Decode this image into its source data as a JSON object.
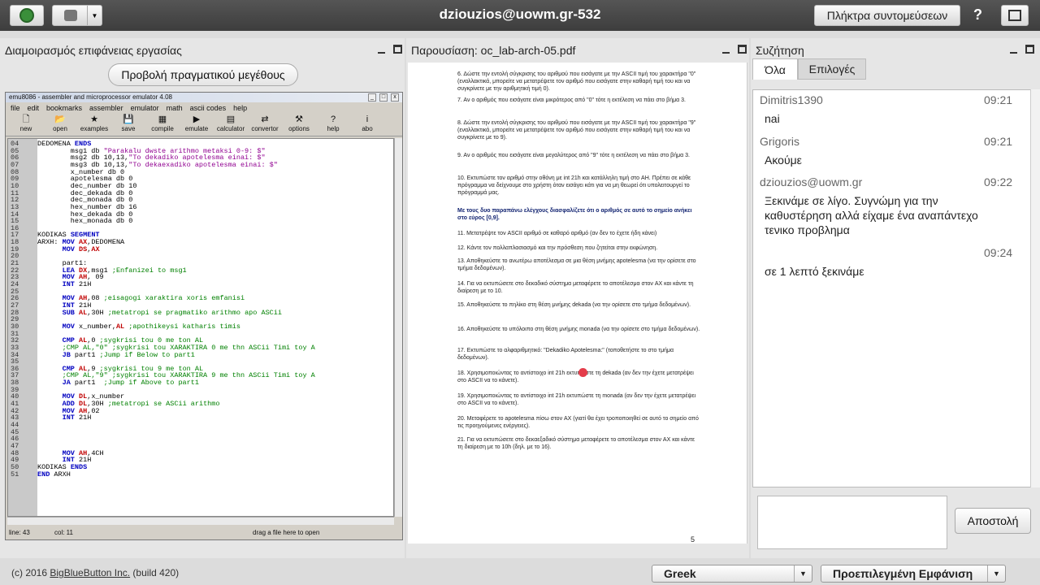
{
  "topbar": {
    "title": "dziouzios@uowm.gr-532",
    "shortcuts_label": "Πλήκτρα συντομεύσεων",
    "help_label": "?"
  },
  "desktop": {
    "title": "Διαμοιρασμός επιφάνειας εργασίας",
    "real_size_label": "Προβολή πραγματικού μεγέθους",
    "emu": {
      "title": "emu8086 - assembler and microprocessor emulator 4.08",
      "menu": [
        "file",
        "edit",
        "bookmarks",
        "assembler",
        "emulator",
        "math",
        "ascii codes",
        "help"
      ],
      "tools": [
        {
          "label": "new",
          "icon": "🗋"
        },
        {
          "label": "open",
          "icon": "📂"
        },
        {
          "label": "examples",
          "icon": "★"
        },
        {
          "label": "save",
          "icon": "💾"
        },
        {
          "label": "compile",
          "icon": "▦"
        },
        {
          "label": "emulate",
          "icon": "▶"
        },
        {
          "label": "calculator",
          "icon": "▤"
        },
        {
          "label": "convertor",
          "icon": "⇄"
        },
        {
          "label": "options",
          "icon": "⚒"
        },
        {
          "label": "help",
          "icon": "?"
        },
        {
          "label": "abo",
          "icon": "i"
        }
      ],
      "status_line": "line: 43",
      "status_col": "col: 11",
      "status_drag": "drag a file here to open"
    },
    "code": [
      {
        "n": "04",
        "t": "DEDOMENA ENDS"
      },
      {
        "n": "05",
        "t": "        msg1 db \"Parakalu dwste arithmo metaksi 0-9: $\""
      },
      {
        "n": "06",
        "t": "        msg2 db 10,13,\"To dekadiko apotelesma einai: $\""
      },
      {
        "n": "07",
        "t": "        msg3 db 10,13,\"To dekaexadiko apotelesma einai: $\""
      },
      {
        "n": "08",
        "t": "        x_number db 0"
      },
      {
        "n": "09",
        "t": "        apotelesma db 0"
      },
      {
        "n": "10",
        "t": "        dec_number db 10"
      },
      {
        "n": "11",
        "t": "        dec_dekada db 0"
      },
      {
        "n": "12",
        "t": "        dec_monada db 0"
      },
      {
        "n": "13",
        "t": "        hex_number db 16"
      },
      {
        "n": "14",
        "t": "        hex_dekada db 0"
      },
      {
        "n": "15",
        "t": "        hex_monada db 0"
      },
      {
        "n": "16",
        "t": ""
      },
      {
        "n": "17",
        "t": "KODIKAS SEGMENT"
      },
      {
        "n": "18",
        "t": "ARXH: MOV AX,DEDOMENA"
      },
      {
        "n": "19",
        "t": "      MOV DS,AX"
      },
      {
        "n": "20",
        "t": ""
      },
      {
        "n": "21",
        "t": "      part1:"
      },
      {
        "n": "22",
        "t": "      LEA DX,msg1 ;Enfanizei to msg1"
      },
      {
        "n": "23",
        "t": "      MOV AH, 09"
      },
      {
        "n": "24",
        "t": "      INT 21H"
      },
      {
        "n": "25",
        "t": ""
      },
      {
        "n": "26",
        "t": "      MOV AH,08 ;eisagogi xaraktira xoris emfanisi"
      },
      {
        "n": "27",
        "t": "      INT 21H"
      },
      {
        "n": "28",
        "t": "      SUB AL,30H ;metatropi se pragmatiko arithmo apo ASCii"
      },
      {
        "n": "29",
        "t": ""
      },
      {
        "n": "30",
        "t": "      MOV x_number,AL ;apothikeysi katharis timis"
      },
      {
        "n": "31",
        "t": ""
      },
      {
        "n": "32",
        "t": "      CMP AL,0 ;sygkrisi tou 0 me ton AL"
      },
      {
        "n": "33",
        "t": "      ;CMP AL,\"0\" ;sygkrisi tou XARAKTIRA 0 me thn ASCii Timi toy A"
      },
      {
        "n": "34",
        "t": "      JB part1 ;Jump if Below to part1"
      },
      {
        "n": "35",
        "t": ""
      },
      {
        "n": "36",
        "t": "      CMP AL,9 ;sygkrisi tou 9 me ton AL"
      },
      {
        "n": "37",
        "t": "      ;CMP AL,\"9\" ;sygkrisi tou XARAKTIRA 9 me thn ASCii Timi toy A"
      },
      {
        "n": "38",
        "t": "      JA part1  ;Jump if Above to part1"
      },
      {
        "n": "39",
        "t": ""
      },
      {
        "n": "40",
        "t": "      MOV DL,x_number"
      },
      {
        "n": "41",
        "t": "      ADD DL,30H ;metatropi se ASCii arithmo"
      },
      {
        "n": "42",
        "t": "      MOV AH,02"
      },
      {
        "n": "43",
        "t": "      INT 21H"
      },
      {
        "n": "44",
        "t": ""
      },
      {
        "n": "45",
        "t": ""
      },
      {
        "n": "46",
        "t": ""
      },
      {
        "n": "47",
        "t": ""
      },
      {
        "n": "48",
        "t": "      MOV AH,4CH"
      },
      {
        "n": "49",
        "t": "      INT 21H"
      },
      {
        "n": "50",
        "t": "KODIKAS ENDS"
      },
      {
        "n": "51",
        "t": "END ARXH"
      }
    ]
  },
  "presentation": {
    "title": "Παρουσίαση: oc_lab-arch-05.pdf",
    "page_number": "5",
    "steps": [
      "6. Δώστε την εντολή σύγκρισης του αριθμού που εισάγατε με την ASCII τιμή του χαρακτήρα \"0\" (εναλλακτικά, μπορείτε να μετατρέψετε τον αριθμό που εισάγατε στην καθαρή τιμή του και να συγκρίνετε με την αριθμητική τιμή 0).",
      "7. Αν ο αριθμός που εισάγατε είναι μικρότερος από \"0\" τότε η εκτέλεση να πάει στο βήμα 3.",
      "8. Δώστε την εντολή σύγκρισης του αριθμού που εισάγατε με την ASCII τιμή του χαρακτήρα \"9\" (εναλλακτικά, μπορείτε να μετατρέψετε τον αριθμό που εισάγατε στην καθαρή τιμή του και να συγκρίνετε με το 9).",
      "9. Αν ο αριθμός που εισάγατε είναι μεγαλύτερος από \"9\" τότε η εκτέλεση να πάει στο βήμα 3.",
      "10. Εκτυπώστε τον αριθμό στην οθόνη με int 21h και κατάλληλη τιμή στο AH. Πρέπει σε κάθε πρόγραμμα να δείχνουμε στο χρήστη όταν εισάγει κάτι για να μη θεωρεί ότι υπολειτουργεί το πρόγραμμά μας.",
      "Με τους δυο παραπάνω ελέγχους διασφαλίζετε ότι ο αριθμός σε αυτό το σημείο ανήκει στο εύρος [0,9].",
      "11. Μετατρέψτε τον ASCII αριθμό σε καθαρό αριθμό (αν δεν το έχετε ήδη κάνει)",
      "12. Κάντε τον πολλαπλασιασμό και την πρόσθεση που ζητείται στην εκφώνηση.",
      "13. Αποθηκεύστε το ανωτέρω αποτέλεσμα σε μια θέση μνήμης apotelesma (να την ορίσετε στο τμήμα δεδομένων).",
      "14. Για να εκτυπώσετε στο δεκαδικό σύστημα μεταφέρετε το αποτέλεσμα στον AX και κάντε τη διαίρεση με το 10.",
      "15. Αποθηκεύστε το πηλίκο στη θέση μνήμης dekada (να την ορίσετε στο τμήμα δεδομένων).",
      "16. Αποθηκεύστε το υπόλοιπο στη θέση μνήμης monada (να την ορίσετε στο τμήμα δεδομένων).",
      "17. Εκτυπώστε το αλφαριθμητικό: \"Dekadiko Apotelesma:\" (τοποθετήστε το στο τμήμα δεδομένων).",
      "18. Χρησιμοποιώντας το αντίστοιχο int 21h εκτυπώστε τη dekada (αν δεν την έχετε μετατρέψει στο ASCII να το κάνετε).",
      "19. Χρησιμοποιώντας το αντίστοιχο int 21h εκτυπώστε τη monada (αν δεν την έχετε μετατρέψει στο ASCII να το κάνετε).",
      "20. Μεταφέρετε το apotelesma πίσω στον AX (γιατί θα έχει τροποποιηθεί σε αυτό το σημείο από τις προηγούμενες ενέργειες).",
      "21. Για να εκτυπώσετε στο δεκαεξαδικό σύστημα μεταφέρετε το αποτέλεσμα στον AX και κάντε τη διαίρεση με το 10h (δηλ. με το 16)."
    ]
  },
  "chat": {
    "title": "Συζήτηση",
    "tab_all": "Όλα",
    "tab_options": "Επιλογές",
    "messages": [
      {
        "name": "Dimitris1390",
        "time": "09:21",
        "text": "nai"
      },
      {
        "name": "Grigoris",
        "time": "09:21",
        "text": "Ακούμε"
      },
      {
        "name": "dziouzios@uowm.gr",
        "time": "09:22",
        "text": "Ξεκινάμε σε λίγο. Συγνώμη για την καθυστέρηση αλλά είχαμε ένα αναπάντεχο τενικο προβλημα"
      },
      {
        "name": "",
        "time": "09:24",
        "text": "σε 1 λεπτό ξεκινάμε"
      }
    ],
    "send_label": "Αποστολή"
  },
  "footer": {
    "copyright_prefix": "(c) 2016 ",
    "copyright_link": "BigBlueButton Inc.",
    "copyright_suffix": " (build 420)",
    "language": "Greek",
    "layout": "Προεπιλεγμένη Εμφάνιση"
  }
}
